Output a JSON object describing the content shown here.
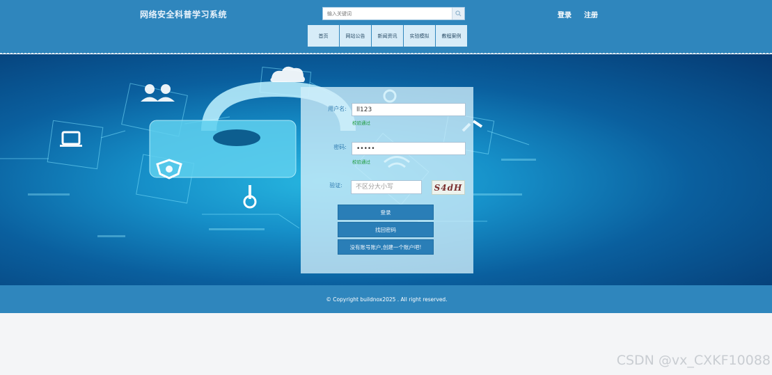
{
  "header": {
    "site_title": "网络安全科普学习系统",
    "search_placeholder": "输入关键词",
    "login_link": "登录",
    "register_link": "注册"
  },
  "nav": {
    "items": [
      "首页",
      "网站公告",
      "新闻资讯",
      "实验模拟",
      "教程案例"
    ]
  },
  "login": {
    "username_label": "用户名:",
    "username_value": "ll123",
    "username_check": "校验通过",
    "password_label": "密码:",
    "password_value": "•••••",
    "password_check": "校验通过",
    "captcha_label": "验证:",
    "captcha_placeholder": "不区分大小写",
    "captcha_text": "S4dH",
    "login_button": "登录",
    "forgot_button": "找回密码",
    "register_button": "没有账号账户,创建一个账户吧!"
  },
  "footer": {
    "copyright": "© Copyright buildnox2025 . All right reserved."
  },
  "watermark": "CSDN @vx_CXKF10088",
  "colors": {
    "header_bg": "#2f86bd",
    "button_bg": "#2a7eb7",
    "success_green": "#1c9a3a"
  }
}
